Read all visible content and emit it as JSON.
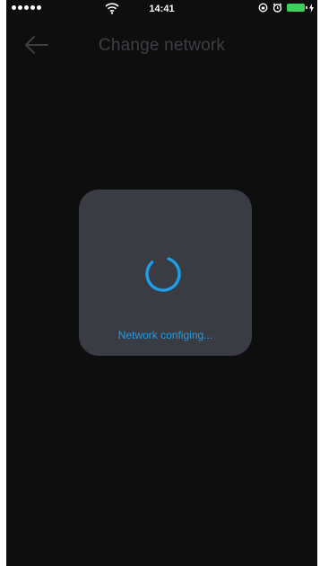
{
  "status_bar": {
    "time": "14:41",
    "signal_dots": 5
  },
  "nav": {
    "back_icon": "arrow-left-icon",
    "title": "Change network"
  },
  "dialog": {
    "spinner_icon": "spinner-icon",
    "message": "Network configing..."
  },
  "colors": {
    "background": "#0e0e0f",
    "dialog": "#3a3c44",
    "accent": "#1e9ee8",
    "title": "#3e3f44",
    "battery": "#3bd15a"
  }
}
